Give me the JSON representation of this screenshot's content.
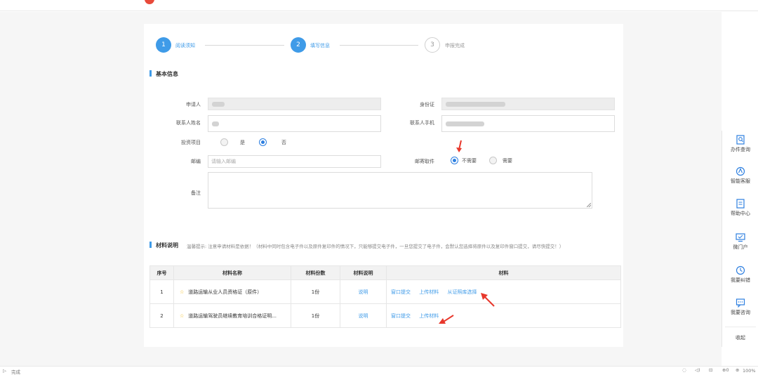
{
  "stepper": [
    {
      "num": "1",
      "label": "阅读须知"
    },
    {
      "num": "2",
      "label": "填写信息"
    },
    {
      "num": "3",
      "label": "申报完成"
    }
  ],
  "basic": {
    "title": "基本信息",
    "applicant_label": "申请人",
    "id_label": "身份证",
    "contact_name_label": "联系人姓名",
    "contact_phone_label": "联系人手机",
    "invest_label": "投资项目",
    "invest_yes": "是",
    "invest_no": "否",
    "postcode_label": "邮编",
    "postcode_placeholder": "请输入邮编",
    "mail_label": "邮寄取件",
    "mail_no": "不需要",
    "mail_yes": "需要",
    "remark_label": "备注"
  },
  "materials": {
    "title": "材料说明",
    "tip": "温馨提示: 注意申请材料是依据！（材料中同时包含电子件以及原件复印件的情况下，只能够提交电子件，一旦您提交了电子件，会默认您选择将原件以及复印件窗口提交，请尽快提交！）",
    "headers": [
      "序号",
      "材料名称",
      "材料份数",
      "材料说明",
      "材料"
    ],
    "rows": [
      {
        "no": "1",
        "name": "道路运输从业人员资格证（原件）",
        "count": "1份",
        "desc": "说明",
        "actions": [
          "窗口提交",
          "上传材料",
          "从证照库选择"
        ]
      },
      {
        "no": "2",
        "name": "道路运输驾驶员继续教育培训合格证明...",
        "count": "1份",
        "desc": "说明",
        "actions": [
          "窗口提交",
          "上传材料"
        ]
      }
    ]
  },
  "side_panel": [
    {
      "label": "办件查询",
      "icon": "search-doc-icon"
    },
    {
      "label": "智能客服",
      "icon": "robot-icon"
    },
    {
      "label": "帮助中心",
      "icon": "help-doc-icon"
    },
    {
      "label": "微门户",
      "icon": "monitor-icon"
    },
    {
      "label": "我要纠错",
      "icon": "clock-icon"
    },
    {
      "label": "我要咨询",
      "icon": "chat-icon"
    },
    {
      "label": "收起",
      "icon": ""
    }
  ],
  "statusbar": {
    "left": "完成",
    "right": "100%"
  },
  "colors": {
    "accent": "#3f9be8",
    "annotation": "#e8382c"
  }
}
